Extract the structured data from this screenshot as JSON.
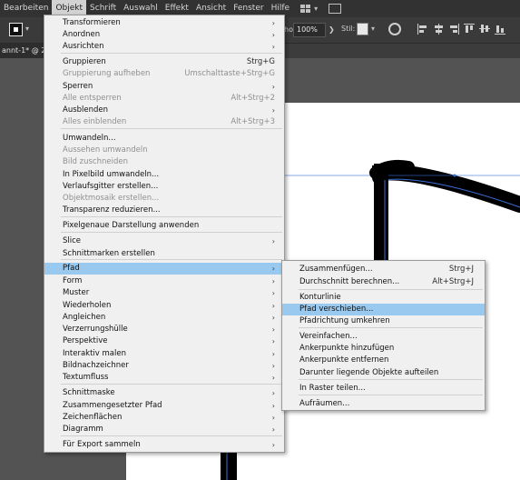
{
  "menubar": {
    "items": [
      "Bearbeiten",
      "Objekt",
      "Schrift",
      "Auswahl",
      "Effekt",
      "Ansicht",
      "Fenster",
      "Hilfe"
    ],
    "active_index": 1
  },
  "controlbar": {
    "opacity_label": "ho",
    "opacity_value": "100%",
    "style_label": "Stil:"
  },
  "document_tab": {
    "title": "annt-1* @ 200"
  },
  "objekt_menu": {
    "items": [
      {
        "label": "Transformieren",
        "shortcut": "",
        "submenu": true,
        "disabled": false
      },
      {
        "label": "Anordnen",
        "shortcut": "",
        "submenu": true,
        "disabled": false
      },
      {
        "label": "Ausrichten",
        "shortcut": "",
        "submenu": true,
        "disabled": false
      },
      {
        "label": "Gruppieren",
        "shortcut": "Strg+G",
        "submenu": false,
        "disabled": false
      },
      {
        "label": "Gruppierung aufheben",
        "shortcut": "Umschalttaste+Strg+G",
        "submenu": false,
        "disabled": true
      },
      {
        "label": "Sperren",
        "shortcut": "",
        "submenu": true,
        "disabled": false
      },
      {
        "label": "Alle entsperren",
        "shortcut": "Alt+Strg+2",
        "submenu": false,
        "disabled": true
      },
      {
        "label": "Ausblenden",
        "shortcut": "",
        "submenu": true,
        "disabled": false
      },
      {
        "label": "Alles einblenden",
        "shortcut": "Alt+Strg+3",
        "submenu": false,
        "disabled": true
      },
      {
        "label": "Umwandeln...",
        "shortcut": "",
        "submenu": false,
        "disabled": false
      },
      {
        "label": "Aussehen umwandeln",
        "shortcut": "",
        "submenu": false,
        "disabled": true
      },
      {
        "label": "Bild zuschneiden",
        "shortcut": "",
        "submenu": false,
        "disabled": true
      },
      {
        "label": "In Pixelbild umwandeln...",
        "shortcut": "",
        "submenu": false,
        "disabled": false
      },
      {
        "label": "Verlaufsgitter erstellen...",
        "shortcut": "",
        "submenu": false,
        "disabled": false
      },
      {
        "label": "Objektmosaik erstellen...",
        "shortcut": "",
        "submenu": false,
        "disabled": true
      },
      {
        "label": "Transparenz reduzieren...",
        "shortcut": "",
        "submenu": false,
        "disabled": false
      },
      {
        "label": "Pixelgenaue Darstellung anwenden",
        "shortcut": "",
        "submenu": false,
        "disabled": false
      },
      {
        "label": "Slice",
        "shortcut": "",
        "submenu": true,
        "disabled": false
      },
      {
        "label": "Schnittmarken erstellen",
        "shortcut": "",
        "submenu": false,
        "disabled": false
      },
      {
        "label": "Pfad",
        "shortcut": "",
        "submenu": true,
        "disabled": false,
        "highlighted": true
      },
      {
        "label": "Form",
        "shortcut": "",
        "submenu": true,
        "disabled": false
      },
      {
        "label": "Muster",
        "shortcut": "",
        "submenu": true,
        "disabled": false
      },
      {
        "label": "Wiederholen",
        "shortcut": "",
        "submenu": true,
        "disabled": false
      },
      {
        "label": "Angleichen",
        "shortcut": "",
        "submenu": true,
        "disabled": false
      },
      {
        "label": "Verzerrungshülle",
        "shortcut": "",
        "submenu": true,
        "disabled": false
      },
      {
        "label": "Perspektive",
        "shortcut": "",
        "submenu": true,
        "disabled": false
      },
      {
        "label": "Interaktiv malen",
        "shortcut": "",
        "submenu": true,
        "disabled": false
      },
      {
        "label": "Bildnachzeichner",
        "shortcut": "",
        "submenu": true,
        "disabled": false
      },
      {
        "label": "Textumfluss",
        "shortcut": "",
        "submenu": true,
        "disabled": false
      },
      {
        "label": "Schnittmaske",
        "shortcut": "",
        "submenu": true,
        "disabled": false
      },
      {
        "label": "Zusammengesetzter Pfad",
        "shortcut": "",
        "submenu": true,
        "disabled": false
      },
      {
        "label": "Zeichenflächen",
        "shortcut": "",
        "submenu": true,
        "disabled": false
      },
      {
        "label": "Diagramm",
        "shortcut": "",
        "submenu": true,
        "disabled": false
      },
      {
        "label": "Für Export sammeln",
        "shortcut": "",
        "submenu": true,
        "disabled": false
      }
    ]
  },
  "pfad_submenu": {
    "items": [
      {
        "label": "Zusammenfügen...",
        "shortcut": "Strg+J",
        "highlighted": false
      },
      {
        "label": "Durchschnitt berechnen...",
        "shortcut": "Alt+Strg+J",
        "highlighted": false
      },
      {
        "label": "Konturlinie",
        "shortcut": "",
        "highlighted": false
      },
      {
        "label": "Pfad verschieben...",
        "shortcut": "",
        "highlighted": true
      },
      {
        "label": "Pfadrichtung umkehren",
        "shortcut": "",
        "highlighted": false
      },
      {
        "label": "Vereinfachen...",
        "shortcut": "",
        "highlighted": false
      },
      {
        "label": "Ankerpunkte hinzufügen",
        "shortcut": "",
        "highlighted": false
      },
      {
        "label": "Ankerpunkte entfernen",
        "shortcut": "",
        "highlighted": false
      },
      {
        "label": "Darunter liegende Objekte aufteilen",
        "shortcut": "",
        "highlighted": false
      },
      {
        "label": "In Raster teilen...",
        "shortcut": "",
        "highlighted": false
      },
      {
        "label": "Aufräumen...",
        "shortcut": "",
        "highlighted": false
      }
    ]
  },
  "colors": {
    "highlight": "#99c9ee",
    "menu_bg": "#f0f0f0",
    "disabled_text": "#8f8f8f",
    "selection_path": "#3b6fd8"
  }
}
